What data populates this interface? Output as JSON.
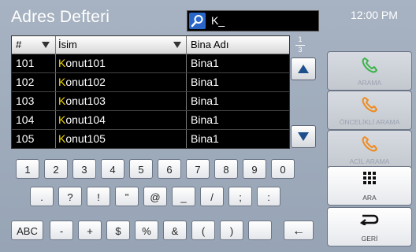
{
  "header": {
    "title": "Adres Defteri",
    "search_text": "K_",
    "clock": "12:00 PM"
  },
  "table": {
    "headers": {
      "no": "#",
      "name": "İsim",
      "building": "Bina Adı"
    },
    "rows": [
      {
        "no": "101",
        "name_first": "K",
        "name_rest": "onut101",
        "building": "Bina1"
      },
      {
        "no": "102",
        "name_first": "K",
        "name_rest": "onut102",
        "building": "Bina1"
      },
      {
        "no": "103",
        "name_first": "K",
        "name_rest": "onut103",
        "building": "Bina1"
      },
      {
        "no": "104",
        "name_first": "K",
        "name_rest": "onut104",
        "building": "Bina1"
      },
      {
        "no": "105",
        "name_first": "K",
        "name_rest": "onut105",
        "building": "Bina1"
      }
    ]
  },
  "pagination": {
    "current": "1",
    "total": "3"
  },
  "keyboard": {
    "row1": [
      "1",
      "2",
      "3",
      "4",
      "5",
      "6",
      "7",
      "8",
      "9",
      "0"
    ],
    "row2": [
      ".",
      "?",
      "!",
      "\"",
      "@",
      "_",
      "/",
      ";",
      ":"
    ],
    "row3": [
      "ABC",
      "-",
      "+",
      "$",
      "%",
      "&",
      "(",
      ")",
      "",
      "←"
    ]
  },
  "side": {
    "call": "ARAMA",
    "priority_call": "ÖNCELİKLİ ARAMA",
    "emergency_call": "ACİL ARAMA",
    "search": "ARA",
    "back": "GERİ"
  },
  "colors": {
    "highlight": "#f1d800",
    "search_icon_bg": "#2a66c8",
    "phone_green": "#3bb34a",
    "phone_orange": "#f08a1c"
  }
}
